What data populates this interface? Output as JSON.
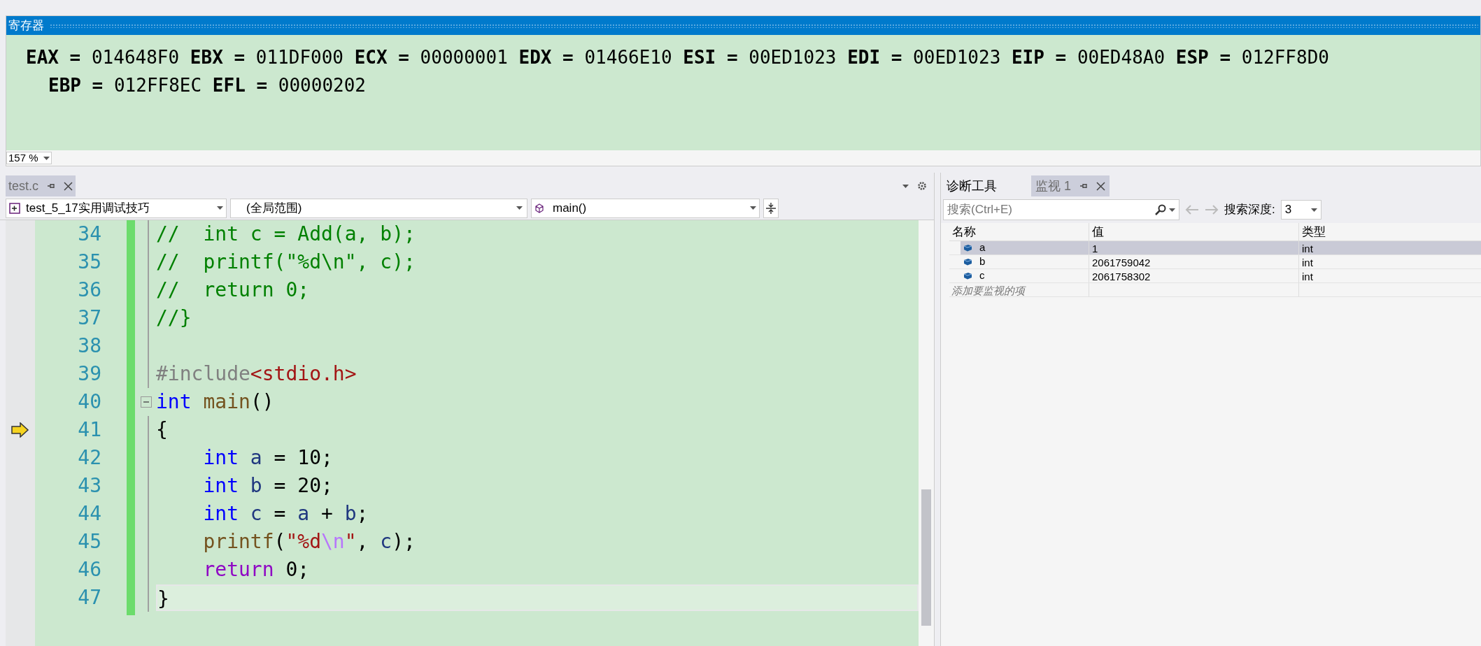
{
  "registers": {
    "title": "寄存器",
    "lines": [
      "**EAX =** 014648F0 **EBX =** 011DF000 **ECX =** 00000001 **EDX =** 01466E10 **ESI =** 00ED1023 **EDI =** 00ED1023 **EIP =** 00ED48A0 **ESP =** 012FF8D0",
      "**EBP =** 012FF8EC **EFL =** 00000202"
    ],
    "zoom": "157 %"
  },
  "editor": {
    "tabs": [
      {
        "label": "test.c",
        "selected": true
      }
    ],
    "project": "test_5_17实用调试技巧",
    "scope": "(全局范围)",
    "function": "main()",
    "lines": [
      {
        "number": "34",
        "fold_toggle": false,
        "tokens": [
          {
            "text": "//  int c = Add(a, b);",
            "kind": "comment"
          }
        ]
      },
      {
        "number": "35",
        "fold_toggle": false,
        "tokens": [
          {
            "text": "//  printf(\"%d\\n\", c);",
            "kind": "comment"
          }
        ]
      },
      {
        "number": "36",
        "fold_toggle": false,
        "tokens": [
          {
            "text": "//  return 0;",
            "kind": "comment"
          }
        ]
      },
      {
        "number": "37",
        "fold_toggle": false,
        "tokens": [
          {
            "text": "//}",
            "kind": "comment"
          }
        ]
      },
      {
        "number": "38",
        "fold_toggle": false
      },
      {
        "number": "39",
        "fold_toggle": false,
        "tokens": [
          {
            "text": "#include",
            "kind": "preproc"
          },
          {
            "text": "<stdio.h>",
            "kind": "path"
          }
        ]
      },
      {
        "number": "40",
        "fold_toggle": true,
        "tokens": [
          {
            "text": "int",
            "kind": "keyword"
          },
          {
            "text": " main",
            "kind": "function"
          },
          {
            "text": "()",
            "kind": "plain"
          }
        ]
      },
      {
        "number": "41",
        "current": true,
        "fold_toggle": false,
        "tokens": [
          {
            "text": "{",
            "kind": "plain"
          }
        ]
      },
      {
        "number": "42",
        "fold_toggle": false,
        "tokens": [
          {
            "text": "    int",
            "kind": "keyword"
          },
          {
            "text": " a",
            "kind": "variable"
          },
          {
            "text": " = 10;",
            "kind": "plain"
          }
        ]
      },
      {
        "number": "43",
        "fold_toggle": false,
        "tokens": [
          {
            "text": "    int",
            "kind": "keyword"
          },
          {
            "text": " b",
            "kind": "variable"
          },
          {
            "text": " = 20;",
            "kind": "plain"
          }
        ]
      },
      {
        "number": "44",
        "fold_toggle": false,
        "tokens": [
          {
            "text": "    int",
            "kind": "keyword"
          },
          {
            "text": " c",
            "kind": "variable"
          },
          {
            "text": " = ",
            "kind": "plain"
          },
          {
            "text": "a",
            "kind": "variable"
          },
          {
            "text": " + ",
            "kind": "plain"
          },
          {
            "text": "b",
            "kind": "variable"
          },
          {
            "text": ";",
            "kind": "plain"
          }
        ]
      },
      {
        "number": "45",
        "fold_toggle": false,
        "tokens": [
          {
            "text": "    printf",
            "kind": "function"
          },
          {
            "text": "(",
            "kind": "plain"
          },
          {
            "text": "\"%d",
            "kind": "string"
          },
          {
            "text": "\\n",
            "kind": "escape"
          },
          {
            "text": "\"",
            "kind": "string"
          },
          {
            "text": ", ",
            "kind": "plain"
          },
          {
            "text": "c",
            "kind": "variable"
          },
          {
            "text": ");",
            "kind": "plain"
          }
        ]
      },
      {
        "number": "46",
        "fold_toggle": false,
        "tokens": [
          {
            "text": "    return",
            "kind": "control"
          },
          {
            "text": " 0;",
            "kind": "plain"
          }
        ]
      },
      {
        "number": "47",
        "highlighted": true,
        "fold_toggle": false,
        "tokens": [
          {
            "text": "}",
            "kind": "plain"
          }
        ]
      }
    ]
  },
  "watch": {
    "tabs": [
      {
        "label": "诊断工具",
        "selected": false
      },
      {
        "label": "监视 1",
        "selected": true
      }
    ],
    "search": {
      "placeholder": "搜索(Ctrl+E)"
    },
    "depth_label": "搜索深度:",
    "depth": "3",
    "columns": [
      "名称",
      "值",
      "类型"
    ],
    "rows": [
      {
        "name": "a",
        "value": "1",
        "type": "int",
        "selected": true
      },
      {
        "name": "b",
        "value": "2061759042",
        "type": "int",
        "selected": false
      },
      {
        "name": "c",
        "value": "2061758302",
        "type": "int",
        "selected": false
      }
    ],
    "add_placeholder": "添加要监视的项"
  }
}
